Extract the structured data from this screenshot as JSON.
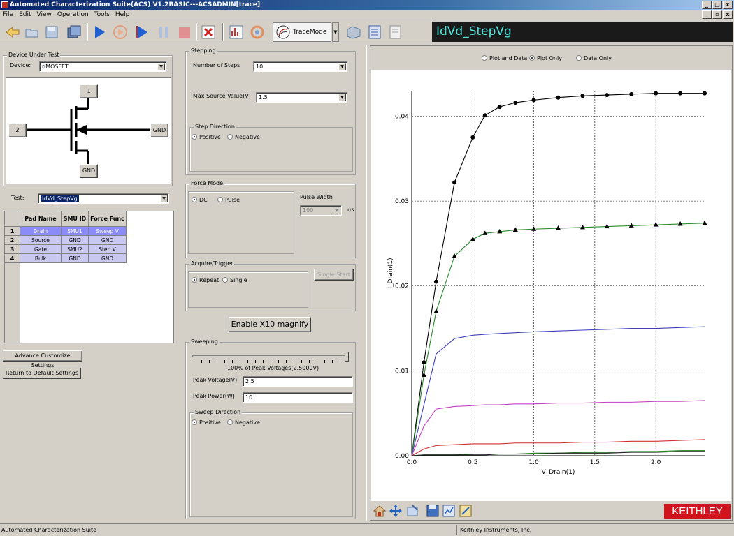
{
  "window": {
    "title": "Automated Characterization Suite(ACS) V1.2BASIC---ACSADMIN[trace]"
  },
  "menu": [
    "File",
    "Edit",
    "View",
    "Operation",
    "Tools",
    "Help"
  ],
  "toolbar": {
    "trace_mode_label": "TraceMode",
    "test_name": "IdVd_StepVg"
  },
  "dut": {
    "group_label": "Device Under Test",
    "device_label": "Device:",
    "device_value": "nMOSFET",
    "pins": {
      "drain": "1",
      "gate": "2",
      "source": "GND",
      "bulk": "GND"
    },
    "test_label": "Test:",
    "test_value": "IdVd_StepVg"
  },
  "pad_table": {
    "headers": [
      "Pad Name",
      "SMU ID",
      "Force Func"
    ],
    "rows": [
      {
        "num": "1",
        "pad": "Drain",
        "smu": "SMU1",
        "func": "Sweep V"
      },
      {
        "num": "2",
        "pad": "Source",
        "smu": "GND",
        "func": "GND"
      },
      {
        "num": "3",
        "pad": "Gate",
        "smu": "SMU2",
        "func": "Step V"
      },
      {
        "num": "4",
        "pad": "Bulk",
        "smu": "GND",
        "func": "GND"
      }
    ]
  },
  "buttons": {
    "advance": "Advance Customize Settings",
    "default": "Return to Default Settings",
    "magnify": "Enable X10 magnify",
    "single_start": "Single Start"
  },
  "stepping": {
    "label": "Stepping",
    "num_steps_label": "Number of Steps",
    "num_steps_value": "10",
    "max_source_label": "Max Source Value(V)",
    "max_source_value": "1.5",
    "direction_label": "Step Direction",
    "positive": "Positive",
    "negative": "Negative"
  },
  "force_mode": {
    "label": "Force Mode",
    "dc": "DC",
    "pulse": "Pulse",
    "pulse_width_label": "Pulse Width",
    "pulse_width_value": "100",
    "unit": "us"
  },
  "acquire": {
    "label": "Acquire/Trigger",
    "repeat": "Repeat",
    "single": "Single"
  },
  "sweeping": {
    "label": "Sweeping",
    "slider_text": "100% of Peak Voltages(2.5000V)",
    "slider_level": 1.0,
    "peak_voltage_label": "Peak Voltage(V)",
    "peak_voltage_value": "2.5",
    "peak_power_label": "Peak Power(W)",
    "peak_power_value": "10",
    "direction_label": "Sweep Direction",
    "positive": "Positive",
    "negative": "Negative"
  },
  "view_options": {
    "plot_and_data": "Plot and Data",
    "plot_only": "Plot Only",
    "data_only": "Data Only"
  },
  "brand": "KEITHLEY",
  "status": {
    "left": "Automated Characterization Suite",
    "right": "Keithley Instruments, Inc."
  },
  "chart_data": {
    "type": "line",
    "xlabel": "V_Drain(1)",
    "ylabel": "I_Drain(1)",
    "xlim": [
      0,
      2.4
    ],
    "ylim": [
      0,
      0.043
    ],
    "xticks": [
      "0.0",
      "0.5",
      "1.0",
      "1.5",
      "2.0"
    ],
    "yticks": [
      "0.00",
      "0.01",
      "0.02",
      "0.03",
      "0.04"
    ],
    "grid": true,
    "x": [
      0,
      0.1,
      0.2,
      0.35,
      0.5,
      0.6,
      0.72,
      0.85,
      1.0,
      1.2,
      1.4,
      1.6,
      1.8,
      2.0,
      2.2,
      2.4
    ],
    "series": [
      {
        "color": "#000000",
        "marker": "circle",
        "values": [
          0,
          0.011,
          0.0205,
          0.0322,
          0.0375,
          0.0401,
          0.0411,
          0.0416,
          0.0419,
          0.0422,
          0.0424,
          0.0425,
          0.0426,
          0.0427,
          0.0427,
          0.0427
        ]
      },
      {
        "color": "#2a8a2a",
        "marker": "triangle",
        "values": [
          0,
          0.0095,
          0.017,
          0.0235,
          0.0255,
          0.0262,
          0.0264,
          0.0266,
          0.0267,
          0.0268,
          0.0269,
          0.027,
          0.0271,
          0.0272,
          0.0273,
          0.0274
        ]
      },
      {
        "color": "#4040c0",
        "marker": "none",
        "values": [
          0,
          0.006,
          0.012,
          0.0138,
          0.0142,
          0.0143,
          0.0144,
          0.0145,
          0.0146,
          0.0147,
          0.0148,
          0.0149,
          0.015,
          0.015,
          0.0151,
          0.0152
        ]
      },
      {
        "color": "#c040c0",
        "marker": "none",
        "values": [
          0,
          0.0035,
          0.0055,
          0.0058,
          0.0059,
          0.006,
          0.006,
          0.0061,
          0.0061,
          0.0062,
          0.0062,
          0.0063,
          0.0063,
          0.0064,
          0.0064,
          0.0065
        ]
      },
      {
        "color": "#d03030",
        "marker": "none",
        "values": [
          0,
          0.0008,
          0.0012,
          0.0013,
          0.0014,
          0.0014,
          0.0014,
          0.0015,
          0.0015,
          0.0015,
          0.0016,
          0.0016,
          0.0017,
          0.0017,
          0.0018,
          0.0019
        ]
      },
      {
        "color": "#208020",
        "marker": "none",
        "values": [
          0,
          0.0001,
          0.0001,
          0.0001,
          0.0002,
          0.0002,
          0.0002,
          0.0002,
          0.0003,
          0.0003,
          0.0004,
          0.0004,
          0.0005,
          0.0005,
          0.0006,
          0.0006
        ]
      },
      {
        "color": "#202020",
        "marker": "none",
        "values": [
          0,
          0.0001,
          0.0001,
          0.0001,
          0.0001,
          0.0001,
          0.0002,
          0.0002,
          0.0002,
          0.0003,
          0.0003,
          0.0003,
          0.0004,
          0.0004,
          0.0005,
          0.0005
        ]
      }
    ]
  }
}
